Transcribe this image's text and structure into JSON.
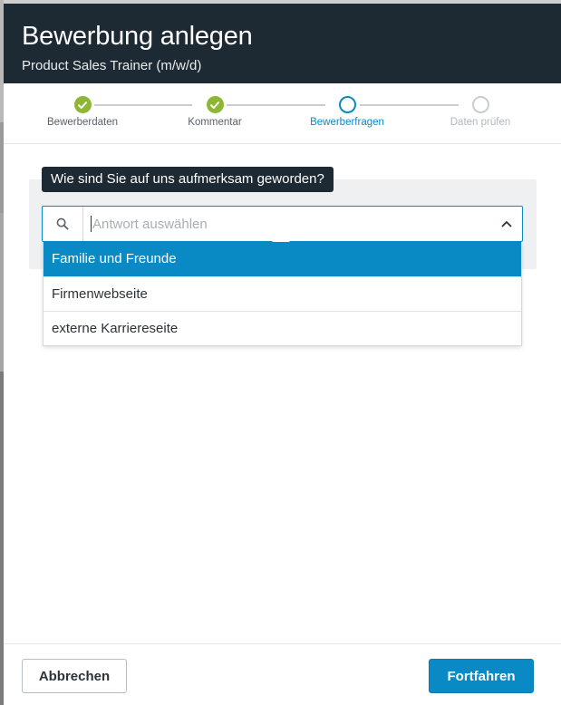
{
  "dialog": {
    "title": "Bewerbung anlegen",
    "subtitle": "Product Sales Trainer (m/w/d)"
  },
  "stepper": {
    "steps": [
      {
        "label": "Bewerberdaten",
        "state": "done"
      },
      {
        "label": "Kommentar",
        "state": "done"
      },
      {
        "label": "Bewerberfragen",
        "state": "active"
      },
      {
        "label": "Daten prüfen",
        "state": "todo"
      }
    ]
  },
  "question": {
    "text": "Wie sind Sie auf uns aufmerksam geworden?",
    "select": {
      "placeholder": "Antwort auswählen",
      "value": "",
      "expanded": true
    },
    "options": [
      {
        "label": "Familie und Freunde",
        "highlighted": true
      },
      {
        "label": "Firmenwebseite",
        "highlighted": false
      },
      {
        "label": "externe Karriereseite",
        "highlighted": false
      }
    ]
  },
  "footer": {
    "cancel_label": "Abbrechen",
    "continue_label": "Fortfahren"
  },
  "colors": {
    "header_bg": "#1e2a33",
    "accent": "#0a8ac5",
    "done": "#8cb634"
  },
  "icons": {
    "step_done": "check-icon",
    "search": "search-icon",
    "chevron": "chevron-up-icon"
  }
}
